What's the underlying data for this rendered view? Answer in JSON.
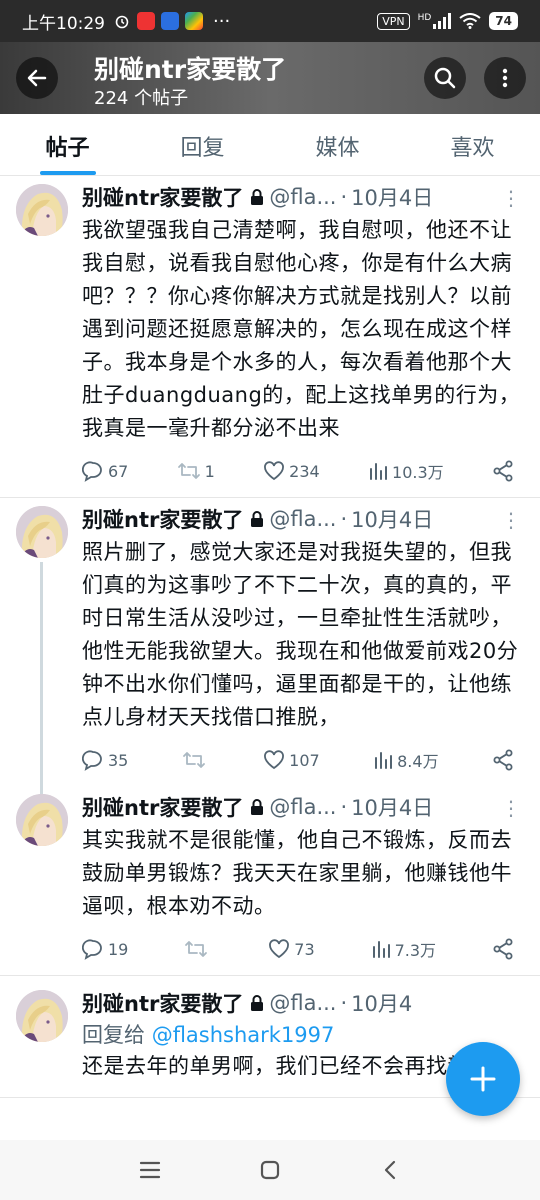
{
  "status_bar": {
    "time": "上午10:29",
    "vpn": "VPN",
    "network": "HD",
    "battery": "74"
  },
  "header": {
    "title": "别碰ntr家要散了",
    "subtitle": "224 个帖子"
  },
  "tabs": [
    "帖子",
    "回复",
    "媒体",
    "喜欢"
  ],
  "posts": [
    {
      "name": "别碰ntr家要散了",
      "handle": "@fla...",
      "date": "10月4日",
      "text": "我欲望强我自己清楚啊，我自慰呗，他还不让我自慰，说看我自慰他心疼，你是有什么大病吧？？？你心疼你解决方式就是找别人？以前遇到问题还挺愿意解决的，怎么现在成这个样子。我本身是个水多的人，每次看着他那个大肚子duangduang的，配上这找单男的行为，我真是一毫升都分泌不出来",
      "replies": "67",
      "retweets": "1",
      "likes": "234",
      "views": "10.3万"
    },
    {
      "name": "别碰ntr家要散了",
      "handle": "@fla...",
      "date": "10月4日",
      "text": "照片删了，感觉大家还是对我挺失望的，但我们真的为这事吵了不下二十次，真的真的，平时日常生活从没吵过，一旦牵扯性生活就吵，他性无能我欲望大。我现在和他做爱前戏20分钟不出水你们懂吗，逼里面都是干的，让他练点儿身材天天找借口推脱，",
      "replies": "35",
      "retweets": "",
      "likes": "107",
      "views": "8.4万"
    },
    {
      "name": "别碰ntr家要散了",
      "handle": "@fla...",
      "date": "10月4日",
      "text": "其实我就不是很能懂，他自己不锻炼，反而去鼓励单男锻炼？我天天在家里躺，他赚钱他牛逼呗，根本劝不动。",
      "replies": "19",
      "retweets": "",
      "likes": "73",
      "views": "7.3万"
    },
    {
      "name": "别碰ntr家要散了",
      "handle": "@fla...",
      "date": "10月4",
      "reply_label": "回复给",
      "reply_handle": "@flashshark1997",
      "text": "还是去年的单男啊，我们已经不会再找新"
    }
  ],
  "colors": {
    "accent": "#1d9bf0",
    "muted": "#536471",
    "text": "#0f1419"
  },
  "icons": [
    "back-arrow-icon",
    "search-icon",
    "more-vertical-icon",
    "lock-icon",
    "reply-icon",
    "retweet-icon",
    "like-icon",
    "views-icon",
    "share-icon",
    "compose-plus-icon",
    "menu-icon",
    "home-square-icon",
    "back-nav-icon"
  ]
}
